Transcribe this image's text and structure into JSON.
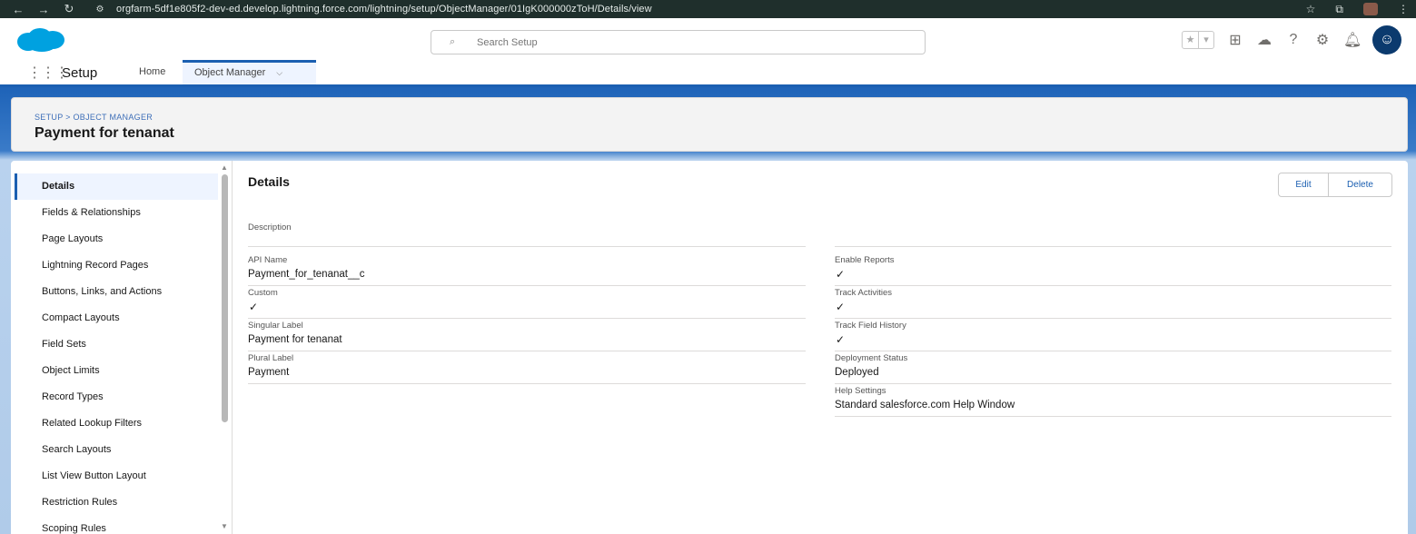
{
  "browser": {
    "url": "orgfarm-5df1e805f2-dev-ed.develop.lightning.force.com/lightning/setup/ObjectManager/01IgK000000zToH/Details/view"
  },
  "header": {
    "search_placeholder": "Search Setup"
  },
  "context": {
    "app_name": "Setup",
    "tabs": [
      {
        "label": "Home"
      },
      {
        "label": "Object Manager"
      }
    ]
  },
  "page": {
    "breadcrumb": "SETUP > OBJECT MANAGER",
    "title": "Payment for tenanat"
  },
  "sidebar": {
    "items": [
      {
        "label": "Details"
      },
      {
        "label": "Fields & Relationships"
      },
      {
        "label": "Page Layouts"
      },
      {
        "label": "Lightning Record Pages"
      },
      {
        "label": "Buttons, Links, and Actions"
      },
      {
        "label": "Compact Layouts"
      },
      {
        "label": "Field Sets"
      },
      {
        "label": "Object Limits"
      },
      {
        "label": "Record Types"
      },
      {
        "label": "Related Lookup Filters"
      },
      {
        "label": "Search Layouts"
      },
      {
        "label": "List View Button Layout"
      },
      {
        "label": "Restriction Rules"
      },
      {
        "label": "Scoping Rules"
      }
    ]
  },
  "details": {
    "title": "Details",
    "edit_label": "Edit",
    "delete_label": "Delete",
    "description_label": "Description",
    "left_fields": [
      {
        "label": "API Name",
        "value": "Payment_for_tenanat__c"
      },
      {
        "label": "Custom",
        "checked": true
      },
      {
        "label": "Singular Label",
        "value": "Payment for tenanat"
      },
      {
        "label": "Plural Label",
        "value": "Payment"
      }
    ],
    "right_fields": [
      {
        "label": "Enable Reports",
        "checked": true
      },
      {
        "label": "Track Activities",
        "checked": true
      },
      {
        "label": "Track Field History",
        "checked": true
      },
      {
        "label": "Deployment Status",
        "value": "Deployed"
      },
      {
        "label": "Help Settings",
        "value": "Standard salesforce.com Help Window"
      }
    ]
  },
  "colors": {
    "brand": "#1b5fb1",
    "banner": "#1e63b8"
  }
}
